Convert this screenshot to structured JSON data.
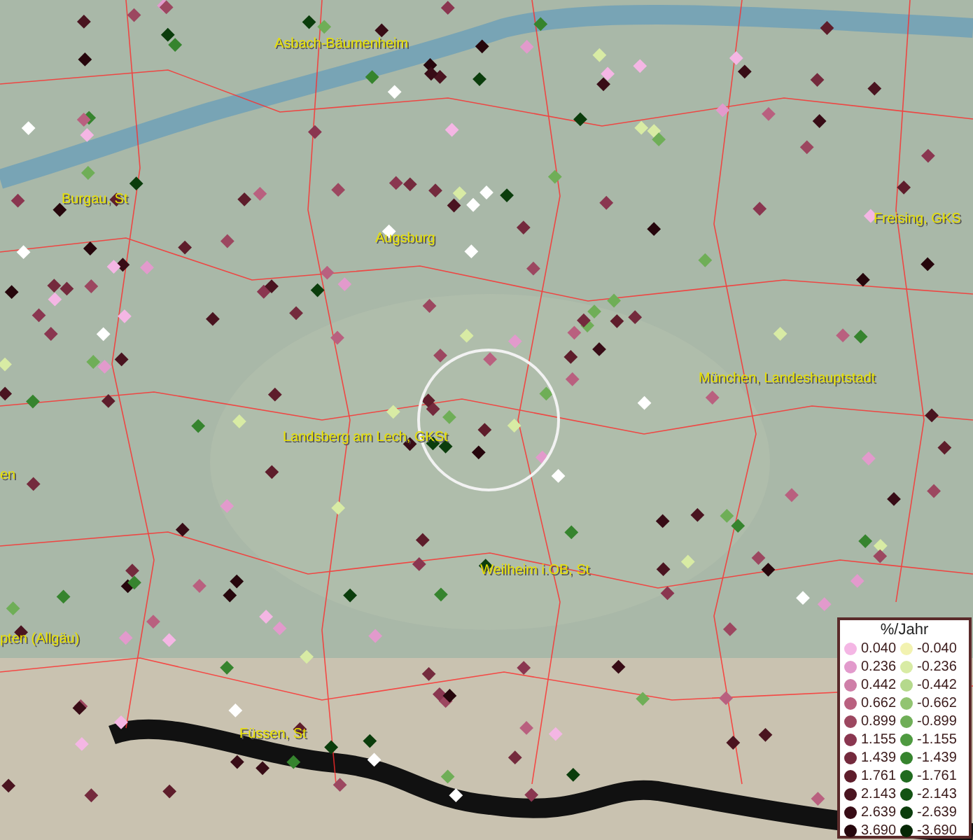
{
  "map": {
    "places": [
      {
        "name": "Asbach-Bäumenheim"
      },
      {
        "name": "Burgau, St"
      },
      {
        "name": "Augsburg"
      },
      {
        "name": "Freising, GKS"
      },
      {
        "name": "München, Landeshauptstadt"
      },
      {
        "name": "Landsberg am Lech, GKSt"
      },
      {
        "name": "en"
      },
      {
        "name": "Weilheim i.OB, St"
      },
      {
        "name": "pten (Allgäu)"
      },
      {
        "name": "Füssen, St"
      }
    ]
  },
  "legend": {
    "title": "%/Jahr",
    "columns": [
      [
        {
          "label": "0.040",
          "color": "#f4b6e4"
        },
        {
          "label": "0.236",
          "color": "#e29acc"
        },
        {
          "label": "0.442",
          "color": "#cf7fa8"
        },
        {
          "label": "0.662",
          "color": "#b9607f"
        },
        {
          "label": "0.899",
          "color": "#9c4760"
        },
        {
          "label": "1.155",
          "color": "#8a3650"
        },
        {
          "label": "1.439",
          "color": "#742a3d"
        },
        {
          "label": "1.761",
          "color": "#5e1d2b"
        },
        {
          "label": "2.143",
          "color": "#4a1420"
        },
        {
          "label": "2.639",
          "color": "#380c16"
        },
        {
          "label": "3.690",
          "color": "#26060c"
        }
      ],
      [
        {
          "label": "-0.040",
          "color": "#f2f2b0"
        },
        {
          "label": "-0.236",
          "color": "#d8eba4"
        },
        {
          "label": "-0.442",
          "color": "#b5d98c"
        },
        {
          "label": "-0.662",
          "color": "#92c471"
        },
        {
          "label": "-0.899",
          "color": "#6fae57"
        },
        {
          "label": "-1.155",
          "color": "#4e9a40"
        },
        {
          "label": "-1.439",
          "color": "#36842e"
        },
        {
          "label": "-1.761",
          "color": "#206b1f"
        },
        {
          "label": "-2.143",
          "color": "#135313"
        },
        {
          "label": "-2.639",
          "color": "#0b3d0c"
        },
        {
          "label": "-3.690",
          "color": "#052805"
        }
      ]
    ]
  }
}
